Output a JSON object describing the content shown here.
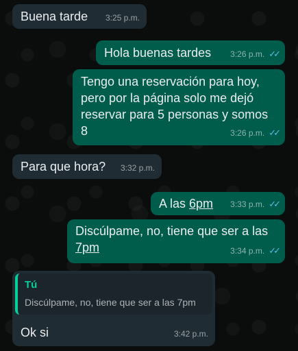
{
  "colors": {
    "background": "#0b0d0c",
    "incoming_bubble": "#202c33",
    "outgoing_bubble": "#005c4b",
    "read_ticks": "#53bdeb",
    "quote_accent": "#06cf9c"
  },
  "messages": [
    {
      "text": "Buena tarde",
      "time": "3:25 p.m."
    },
    {
      "text": "Hola buenas tardes",
      "time": "3:26 p.m.",
      "ticks": "✓✓"
    },
    {
      "text": "Tengo una reservación para hoy, pero por la página solo me dejó reservar para 5 personas y somos 8",
      "time": "3:26 p.m.",
      "ticks": "✓✓"
    },
    {
      "text": "Para que hora?",
      "time": "3:32 p.m."
    },
    {
      "text_pre": "A las ",
      "text_link": "6pm",
      "time": "3:33 p.m.",
      "ticks": "✓✓"
    },
    {
      "text_pre": "Discúlpame, no, tiene que ser a las ",
      "text_link": "7pm",
      "time": "3:34 p.m.",
      "ticks": "✓✓"
    },
    {
      "quote_author": "Tú",
      "quote_text": "Discúlpame, no, tiene que ser a las 7pm",
      "text": "Ok si",
      "time": "3:42 p.m."
    }
  ]
}
